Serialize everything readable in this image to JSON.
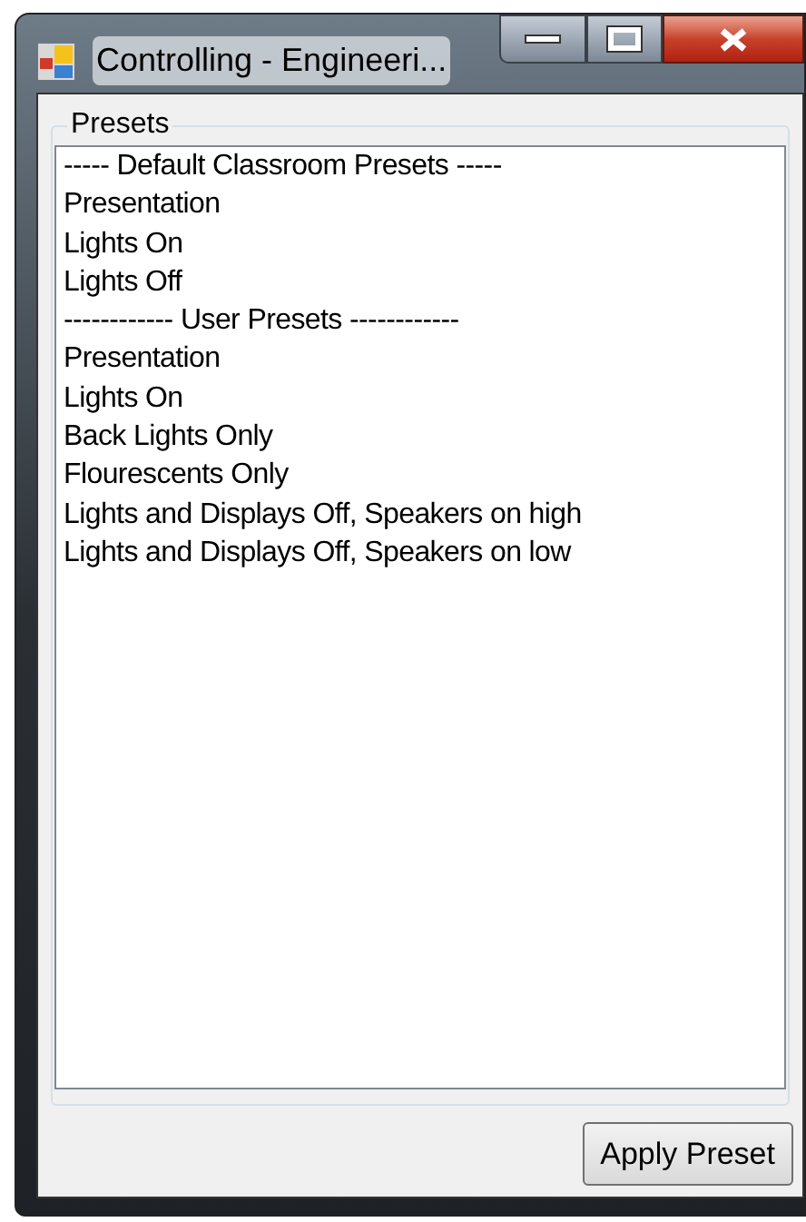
{
  "window": {
    "title": "Controlling - Engineeri..."
  },
  "presets": {
    "label": "Presets",
    "items": [
      "----- Default Classroom Presets -----",
      "Presentation",
      "Lights On",
      "Lights Off",
      "------------ User Presets ------------",
      "Presentation",
      "Lights On",
      "Back Lights Only",
      "Flourescents Only",
      "Lights and Displays Off, Speakers on high",
      "Lights and Displays Off, Speakers on low"
    ]
  },
  "buttons": [
    "Apply Preset"
  ]
}
